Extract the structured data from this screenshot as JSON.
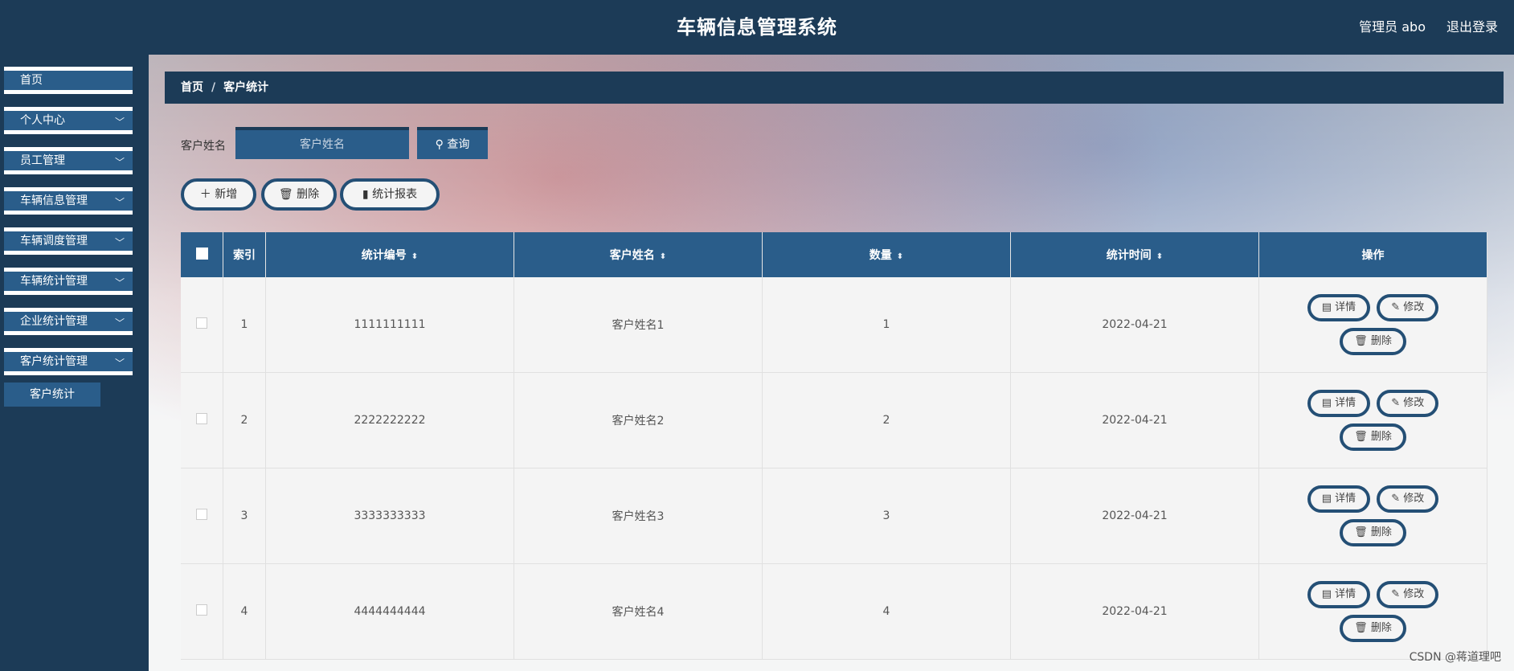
{
  "header": {
    "title": "车辆信息管理系统",
    "admin": "管理员 abo",
    "logout": "退出登录"
  },
  "sidebar": {
    "items": [
      {
        "label": "首页",
        "has_chevron": false
      },
      {
        "label": "个人中心",
        "has_chevron": true
      },
      {
        "label": "员工管理",
        "has_chevron": true
      },
      {
        "label": "车辆信息管理",
        "has_chevron": true
      },
      {
        "label": "车辆调度管理",
        "has_chevron": true
      },
      {
        "label": "车辆统计管理",
        "has_chevron": true
      },
      {
        "label": "企业统计管理",
        "has_chevron": true
      },
      {
        "label": "客户统计管理",
        "has_chevron": true
      }
    ],
    "submenu": {
      "label": "客户统计"
    }
  },
  "breadcrumb": {
    "home": "首页",
    "sep": "/",
    "current": "客户统计"
  },
  "search": {
    "label": "客户姓名",
    "placeholder": "客户姓名",
    "button": "查询",
    "button_icon": "search-icon"
  },
  "toolbar": {
    "add": "新增",
    "delete": "删除",
    "report": "统计报表"
  },
  "table": {
    "headers": {
      "index": "索引",
      "code": "统计编号",
      "name": "客户姓名",
      "qty": "数量",
      "time": "统计时间",
      "ops": "操作"
    },
    "rows": [
      {
        "index": "1",
        "code": "1111111111",
        "name": "客户姓名1",
        "qty": "1",
        "time": "2022-04-21"
      },
      {
        "index": "2",
        "code": "2222222222",
        "name": "客户姓名2",
        "qty": "2",
        "time": "2022-04-21"
      },
      {
        "index": "3",
        "code": "3333333333",
        "name": "客户姓名3",
        "qty": "3",
        "time": "2022-04-21"
      },
      {
        "index": "4",
        "code": "4444444444",
        "name": "客户姓名4",
        "qty": "4",
        "time": "2022-04-21"
      }
    ],
    "actions": {
      "detail": "详情",
      "edit": "修改",
      "delete": "删除"
    }
  },
  "watermark": "CSDN @蒋道理吧",
  "colors": {
    "header_bg": "#1c3b57",
    "accent": "#2a5d8a",
    "pill_border": "#244f75"
  }
}
